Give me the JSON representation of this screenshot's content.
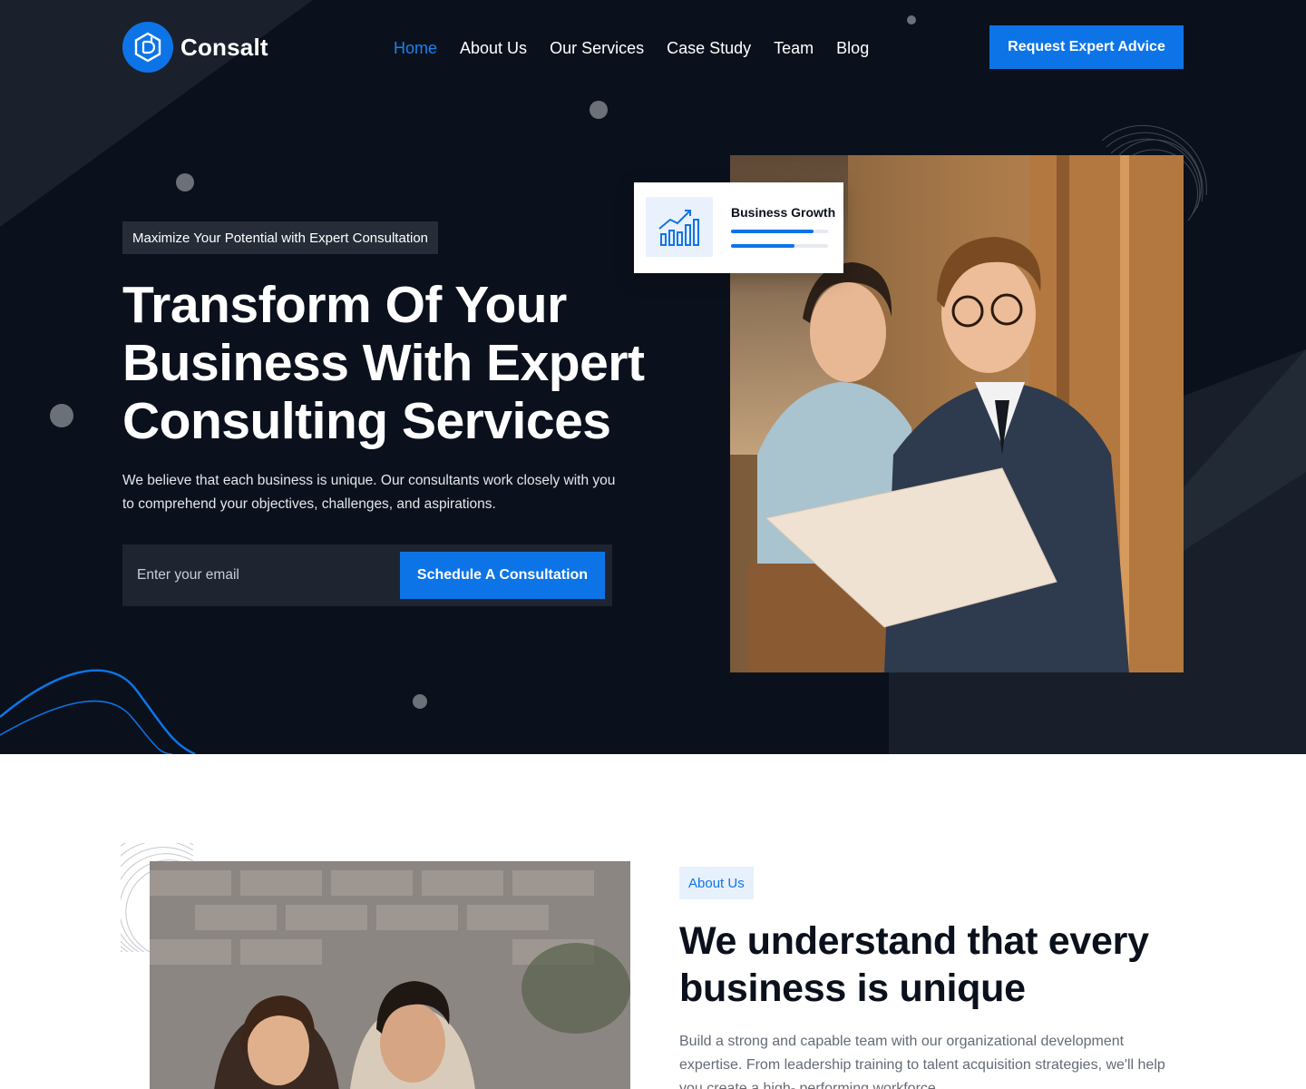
{
  "brand": {
    "name": "Consalt",
    "accent": "#0d74e8",
    "dark_bg": "#0b111c"
  },
  "nav": {
    "items": [
      {
        "label": "Home",
        "active": true
      },
      {
        "label": "About Us",
        "active": false
      },
      {
        "label": "Our Services",
        "active": false
      },
      {
        "label": "Case Study",
        "active": false
      },
      {
        "label": "Team",
        "active": false
      },
      {
        "label": "Blog",
        "active": false
      }
    ],
    "cta_label": "Request Expert Advice"
  },
  "hero": {
    "tagline": "Maximize Your Potential with Expert Consultation",
    "title": "Transform Of Your Business With Expert Consulting Services",
    "description": "We believe that each business is unique. Our consultants work closely with you to comprehend your objectives, challenges, and aspirations.",
    "email_placeholder": "Enter your email",
    "submit_label": "Schedule A Consultation",
    "photo_icon": "people-reviewing-document-photo"
  },
  "growth_card": {
    "label": "Business Growth",
    "icon": "bar-chart-growth-icon",
    "progress": [
      0.85,
      0.65
    ]
  },
  "about": {
    "badge": "About Us",
    "title": "We understand that every business is unique",
    "description": "Build a strong and capable team with our organizational development expertise. From leadership training to talent acquisition strategies, we'll help you create a high- performing workforce.",
    "photo_icon": "team-at-laptop-photo"
  }
}
